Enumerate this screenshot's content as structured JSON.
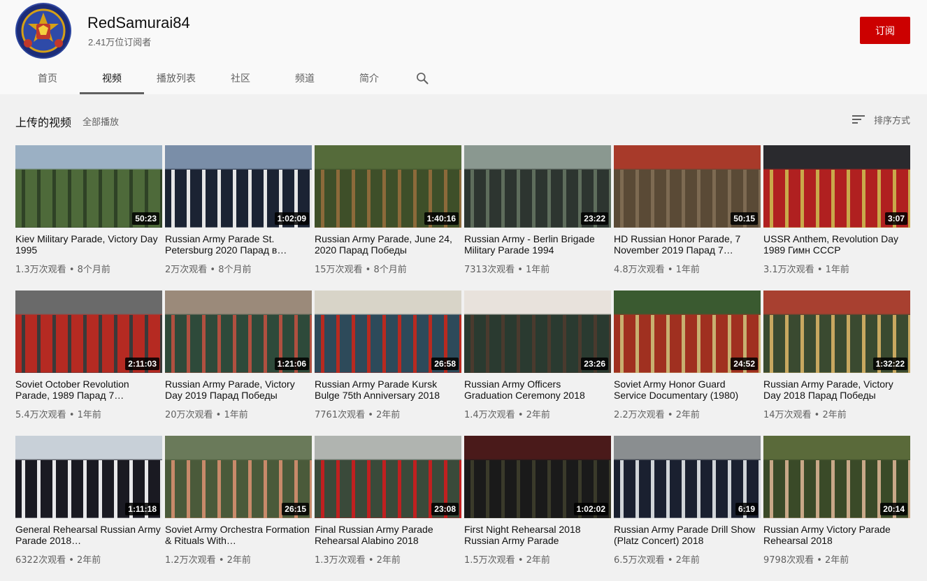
{
  "channel": {
    "name": "RedSamurai84",
    "subscribers": "2.41万位订阅者",
    "subscribe_label": "订阅"
  },
  "tabs": [
    {
      "label": "首页",
      "active": false
    },
    {
      "label": "视频",
      "active": true
    },
    {
      "label": "播放列表",
      "active": false
    },
    {
      "label": "社区",
      "active": false
    },
    {
      "label": "频道",
      "active": false
    },
    {
      "label": "简介",
      "active": false
    }
  ],
  "section": {
    "title": "上传的视频",
    "play_all": "全部播放",
    "sort_label": "排序方式"
  },
  "colors": {
    "subscribe": "#cc0000",
    "header_bg": "#f9f9f9",
    "page_bg": "#f1f1f1",
    "text_secondary": "#606060"
  },
  "videos": [
    {
      "title": "Kiev Military Parade, Victory Day 1995",
      "duration": "50:23",
      "views": "1.3万次观看",
      "age": "8个月前",
      "palette": [
        "#9bb0c4",
        "#4e6a3a",
        "#2f4226"
      ]
    },
    {
      "title": "Russian Army Parade St. Petersburg 2020 Парад в…",
      "duration": "1:02:09",
      "views": "2万次观看",
      "age": "8个月前",
      "palette": [
        "#7a8ea8",
        "#1b2333",
        "#e6e6e6"
      ]
    },
    {
      "title": "Russian Army Parade, June 24, 2020 Парад Победы",
      "duration": "1:40:16",
      "views": "15万次观看",
      "age": "8个月前",
      "palette": [
        "#556b3a",
        "#3e4f29",
        "#8c6a3a"
      ]
    },
    {
      "title": "Russian Army - Berlin Brigade Military Parade 1994",
      "duration": "23:22",
      "views": "7313次观看",
      "age": "1年前",
      "palette": [
        "#8a9890",
        "#2d3530",
        "#5e6d5c"
      ]
    },
    {
      "title": "HD Russian Honor Parade, 7 November 2019 Парад 7…",
      "duration": "50:15",
      "views": "4.8万次观看",
      "age": "1年前",
      "palette": [
        "#a83a2a",
        "#5a4a36",
        "#7d6a52"
      ]
    },
    {
      "title": "USSR Anthem, Revolution Day 1989 Гимн СССР",
      "duration": "3:07",
      "views": "3.1万次观看",
      "age": "1年前",
      "palette": [
        "#2a2a2e",
        "#b02020",
        "#c9a94a"
      ]
    },
    {
      "title": "Soviet October Revolution Parade, 1989 Парад 7…",
      "duration": "2:11:03",
      "views": "5.4万次观看",
      "age": "1年前",
      "palette": [
        "#6a6a6a",
        "#b52a22",
        "#3a3a3a"
      ]
    },
    {
      "title": "Russian Army Parade, Victory Day 2019 Парад Победы",
      "duration": "1:21:06",
      "views": "20万次观看",
      "age": "1年前",
      "palette": [
        "#9b8a7a",
        "#2e4a3a",
        "#b05040"
      ]
    },
    {
      "title": "Russian Army Parade Kursk Bulge 75th Anniversary 2018",
      "duration": "26:58",
      "views": "7761次观看",
      "age": "2年前",
      "palette": [
        "#d8d4c8",
        "#2d4a5a",
        "#b82a20"
      ]
    },
    {
      "title": "Russian Army Officers Graduation Ceremony 2018",
      "duration": "23:26",
      "views": "1.4万次观看",
      "age": "2年前",
      "palette": [
        "#e8e2dc",
        "#2a3a30",
        "#4a3a2e"
      ]
    },
    {
      "title": "Soviet Army Honor Guard Service Documentary (1980)",
      "duration": "24:52",
      "views": "2.2万次观看",
      "age": "2年前",
      "palette": [
        "#3a5a30",
        "#a03020",
        "#c8b070"
      ]
    },
    {
      "title": "Russian Army Parade, Victory Day 2018 Парад Победы",
      "duration": "1:32:22",
      "views": "14万次观看",
      "age": "2年前",
      "palette": [
        "#a84030",
        "#3a4a30",
        "#c8a860"
      ]
    },
    {
      "title": "General Rehearsal Russian Army Parade 2018…",
      "duration": "1:11:18",
      "views": "6322次观看",
      "age": "2年前",
      "palette": [
        "#c8d0d8",
        "#1a1a22",
        "#e8e8ea"
      ]
    },
    {
      "title": "Soviet Army Orchestra Formation & Rituals With…",
      "duration": "26:15",
      "views": "1.2万次观看",
      "age": "2年前",
      "palette": [
        "#6a7a5a",
        "#4a5a3a",
        "#c88a6a"
      ]
    },
    {
      "title": "Final Russian Army Parade Rehearsal Alabino 2018",
      "duration": "23:08",
      "views": "1.3万次观看",
      "age": "2年前",
      "palette": [
        "#b0b4b0",
        "#3a4a3a",
        "#c02020"
      ]
    },
    {
      "title": "First Night Rehearsal 2018 Russian Army Parade",
      "duration": "1:02:02",
      "views": "1.5万次观看",
      "age": "2年前",
      "palette": [
        "#4a1a1a",
        "#1a1a1a",
        "#3a3a2a"
      ]
    },
    {
      "title": "Russian Army Parade Drill Show (Platz Concert) 2018",
      "duration": "6:19",
      "views": "6.5万次观看",
      "age": "2年前",
      "palette": [
        "#8a8e90",
        "#1a2030",
        "#d0d4d8"
      ]
    },
    {
      "title": "Russian Army Victory Parade Rehearsal 2018",
      "duration": "20:14",
      "views": "9798次观看",
      "age": "2年前",
      "palette": [
        "#5a6a3a",
        "#3a4a28",
        "#c8a888"
      ]
    }
  ]
}
